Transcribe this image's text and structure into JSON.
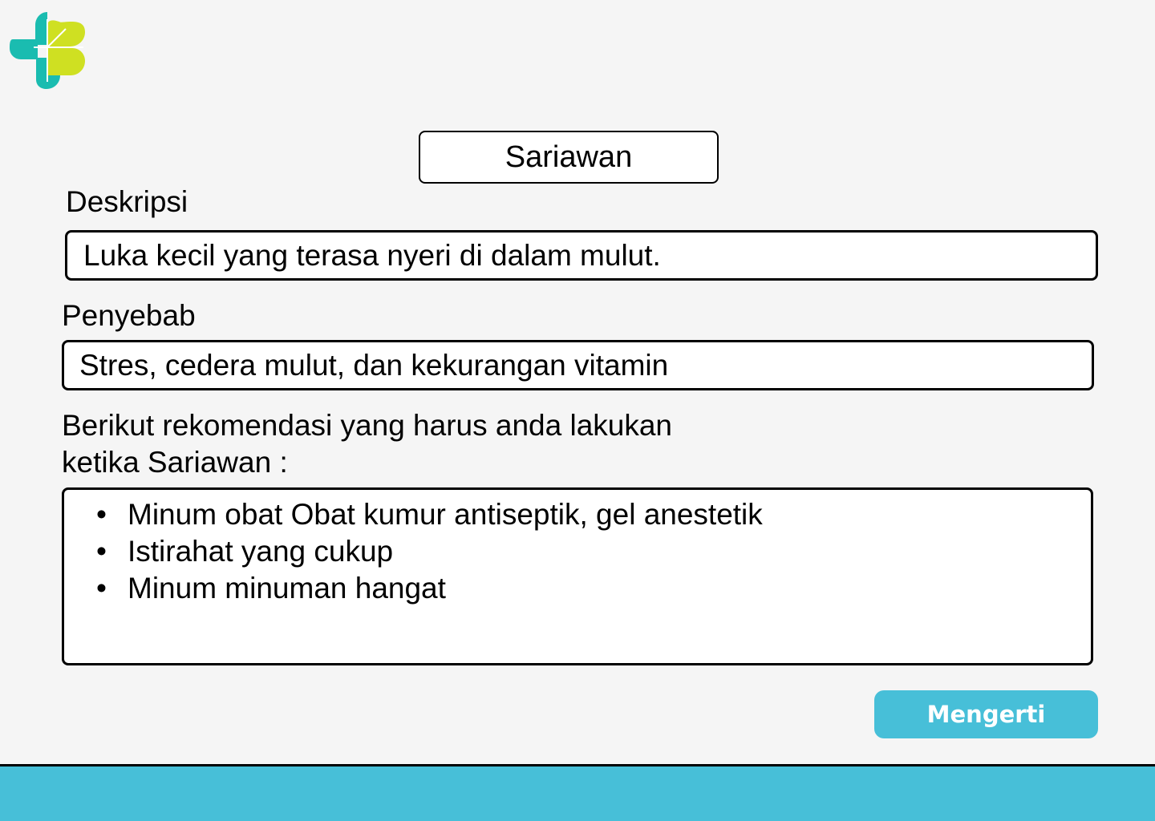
{
  "colors": {
    "accent": "#47bfd8",
    "logo_teal": "#1abcb0",
    "logo_lime": "#cfe022",
    "background": "#f5f5f5"
  },
  "logo": {
    "icon": "kemenkes-logo-icon"
  },
  "title": "Sariawan",
  "description": {
    "label": "Deskripsi",
    "value": "Luka kecil yang terasa nyeri di dalam mulut."
  },
  "cause": {
    "label": "Penyebab",
    "value": "Stres, cedera mulut, dan kekurangan vitamin"
  },
  "recommendation": {
    "heading_line1": "Berikut rekomendasi yang harus anda lakukan",
    "heading_line2": "ketika Sariawan :",
    "bullet": "•",
    "items": [
      "Minum obat Obat kumur antiseptik, gel anestetik",
      "Istirahat yang cukup",
      "Minum minuman hangat"
    ]
  },
  "button": {
    "label": "Mengerti"
  }
}
